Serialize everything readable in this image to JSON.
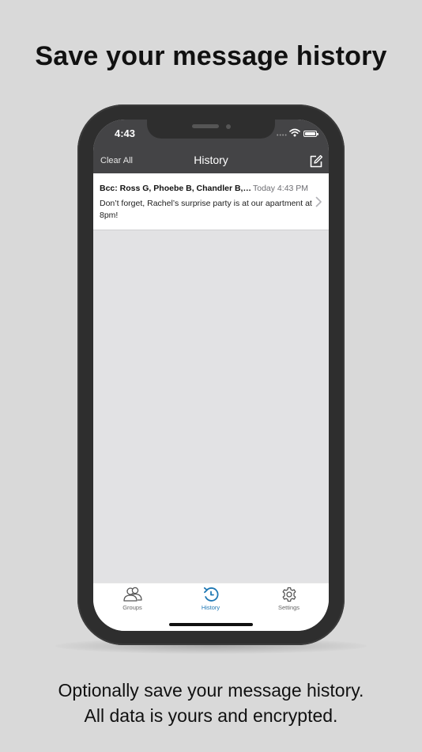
{
  "headline": "Save your message history",
  "caption": {
    "line1": "Optionally save your message history.",
    "line2": "All data is yours and encrypted."
  },
  "status_bar": {
    "time": "4:43"
  },
  "nav": {
    "left_button": "Clear All",
    "title": "History",
    "right_icon": "compose-icon"
  },
  "history": [
    {
      "recipients": "Bcc: Ross G, Phoebe B, Chandler B, J...",
      "date": "Today 4:43 PM",
      "message": "Don’t forget, Rachel’s surprise party is at our apartment at 8pm!"
    }
  ],
  "tabs": [
    {
      "label": "Groups",
      "icon": "groups-icon",
      "active": false
    },
    {
      "label": "History",
      "icon": "history-icon",
      "active": true
    },
    {
      "label": "Settings",
      "icon": "gear-icon",
      "active": false
    }
  ],
  "colors": {
    "background": "#d9d9d9",
    "phone_frame": "#2e2e2e",
    "nav_bar": "#444446",
    "accent": "#1f78b4"
  }
}
